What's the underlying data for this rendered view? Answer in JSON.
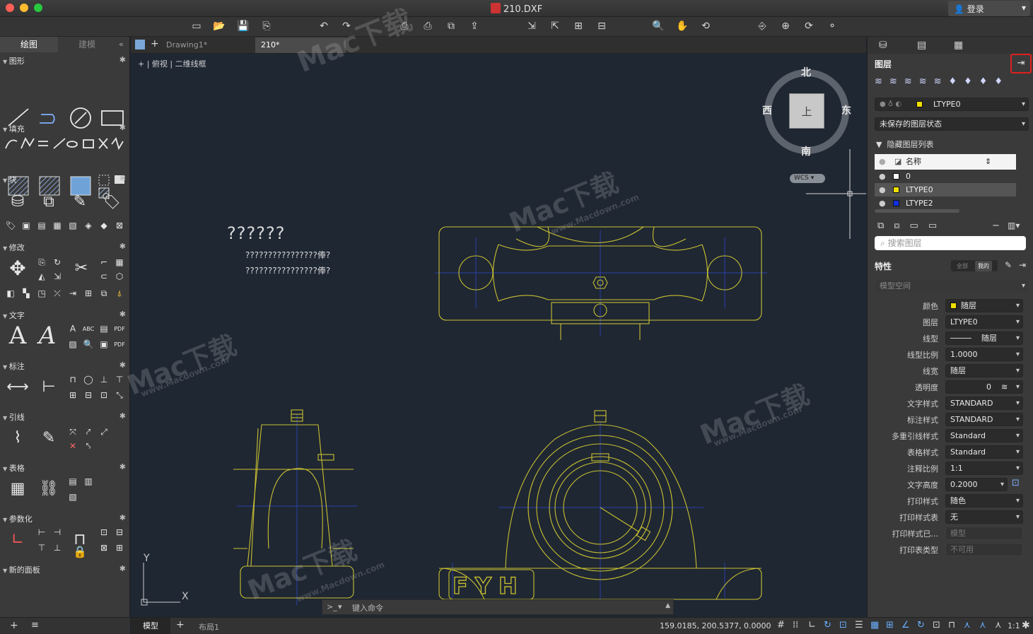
{
  "window": {
    "title": "210.DXF",
    "login": "登录"
  },
  "left_panel": {
    "tabs": [
      "绘图",
      "建模"
    ],
    "sections": [
      "图形",
      "填充",
      "块",
      "修改",
      "文字",
      "标注",
      "引线",
      "表格",
      "参数化",
      "新的面板"
    ]
  },
  "doc_tabs": [
    "Drawing1*",
    "210*"
  ],
  "view_label": "+ | 俯视 | 二维线框",
  "viewcube": {
    "north": "北",
    "south": "南",
    "east": "东",
    "west": "西",
    "top": "上",
    "wcs": "WCS"
  },
  "drawing_text": {
    "title": "??????",
    "line1": "????????????????俸?",
    "line2": "????????????????俸?",
    "stamp": "FYH"
  },
  "axes": {
    "x": "X",
    "y": "Y"
  },
  "command": {
    "prompt": ">_",
    "placeholder": "键入命令"
  },
  "status": {
    "model_tab": "模型",
    "layout_tab": "布局1",
    "coords": "159.0185, 200.5377, 0.0000",
    "scale": "1:1"
  },
  "layers": {
    "header": "图层",
    "current": "LTYPE0",
    "state": "未保存的图层状态",
    "hidden_list": "隐藏图层列表",
    "col_name": "名称",
    "rows": [
      {
        "name": "0",
        "color": "#ffffff"
      },
      {
        "name": "LTYPE0",
        "color": "#f0e000"
      },
      {
        "name": "LTYPE2",
        "color": "#1030e0"
      }
    ],
    "search_placeholder": "搜索图层"
  },
  "properties": {
    "header": "特性",
    "filter_all": "全部",
    "filter_mine": "我的",
    "space": "模型空间",
    "rows": [
      {
        "label": "颜色",
        "value": "随层"
      },
      {
        "label": "图层",
        "value": "LTYPE0"
      },
      {
        "label": "线型",
        "value": "随层"
      },
      {
        "label": "线型比例",
        "value": "1.0000"
      },
      {
        "label": "线宽",
        "value": "随层"
      },
      {
        "label": "透明度",
        "value": "0"
      },
      {
        "label": "文字样式",
        "value": "STANDARD"
      },
      {
        "label": "标注样式",
        "value": "STANDARD"
      },
      {
        "label": "多重引线样式",
        "value": "Standard"
      },
      {
        "label": "表格样式",
        "value": "Standard"
      },
      {
        "label": "注释比例",
        "value": "1:1"
      },
      {
        "label": "文字高度",
        "value": "0.2000"
      },
      {
        "label": "打印样式",
        "value": "随色"
      },
      {
        "label": "打印样式表",
        "value": "无"
      },
      {
        "label": "打印样式已...",
        "value": "模型"
      },
      {
        "label": "打印表类型",
        "value": "不可用"
      }
    ]
  },
  "watermark": {
    "brand": "Mac下载",
    "url": "www.Macdown.com"
  },
  "colors": {
    "drawing": "#c8c030",
    "centerline": "#2a3fa8",
    "canvas_bg": "#1f2733",
    "highlight": "#e02020"
  }
}
